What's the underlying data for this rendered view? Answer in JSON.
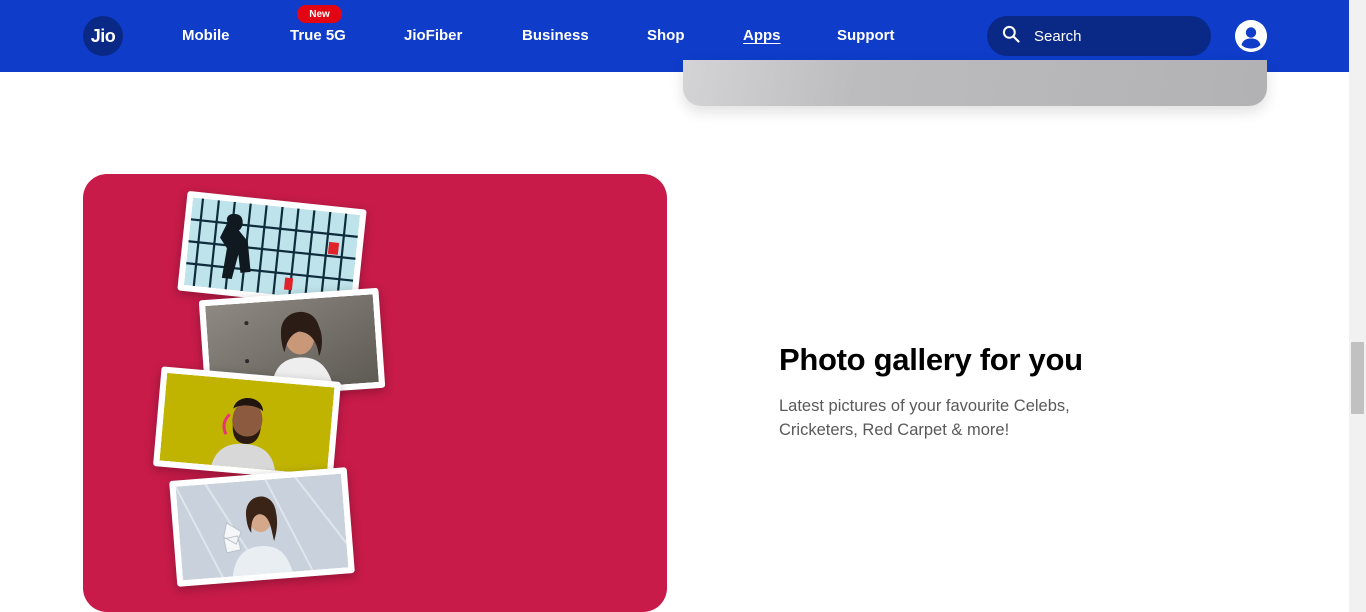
{
  "header": {
    "logo_text": "Jio",
    "nav": [
      {
        "label": "Mobile"
      },
      {
        "label": "True 5G",
        "badge": "New"
      },
      {
        "label": "JioFiber"
      },
      {
        "label": "Business"
      },
      {
        "label": "Shop"
      },
      {
        "label": "Apps",
        "active": true
      },
      {
        "label": "Support"
      }
    ],
    "search": {
      "placeholder": "Search",
      "icon": "search-icon"
    },
    "account_icon": "user-icon"
  },
  "gallery": {
    "title": "Photo gallery for you",
    "description": "Latest pictures of your favourite Celebs, Cricketers, Red Carpet & more!",
    "photos": [
      "celebrity-photo",
      "celebrity-photo",
      "cricketer-photo",
      "red-carpet-photo"
    ]
  },
  "colors": {
    "header_bg": "#0f3cc9",
    "search_bg": "#0a2885",
    "badge_bg": "#e30513",
    "card_bg": "#c81b4a"
  }
}
